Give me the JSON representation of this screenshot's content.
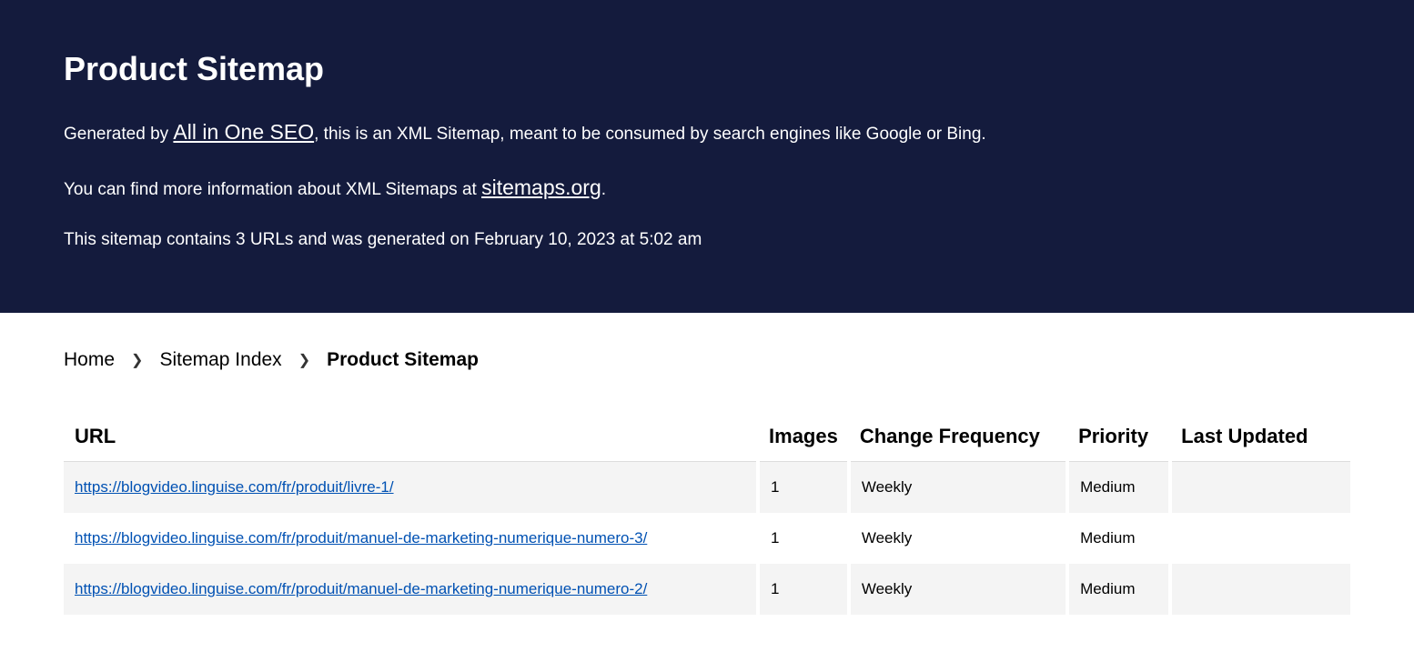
{
  "header": {
    "title": "Product Sitemap",
    "line1_pre": "Generated by ",
    "line1_link": "All in One SEO",
    "line1_post": ", this is an XML Sitemap, meant to be consumed by search engines like Google or Bing.",
    "line2_pre": "You can find more information about XML Sitemaps at ",
    "line2_link": "sitemaps.org",
    "line2_post": ".",
    "line3": "This sitemap contains 3 URLs and was generated on February 10, 2023 at 5:02 am"
  },
  "breadcrumb": {
    "home": "Home",
    "index": "Sitemap Index",
    "current": "Product Sitemap"
  },
  "table": {
    "headers": {
      "url": "URL",
      "images": "Images",
      "freq": "Change Frequency",
      "priority": "Priority",
      "updated": "Last Updated"
    },
    "rows": [
      {
        "url": "https://blogvideo.linguise.com/fr/produit/livre-1/",
        "images": "1",
        "freq": "Weekly",
        "priority": "Medium",
        "updated": ""
      },
      {
        "url": "https://blogvideo.linguise.com/fr/produit/manuel-de-marketing-numerique-numero-3/",
        "images": "1",
        "freq": "Weekly",
        "priority": "Medium",
        "updated": ""
      },
      {
        "url": "https://blogvideo.linguise.com/fr/produit/manuel-de-marketing-numerique-numero-2/",
        "images": "1",
        "freq": "Weekly",
        "priority": "Medium",
        "updated": ""
      }
    ]
  }
}
